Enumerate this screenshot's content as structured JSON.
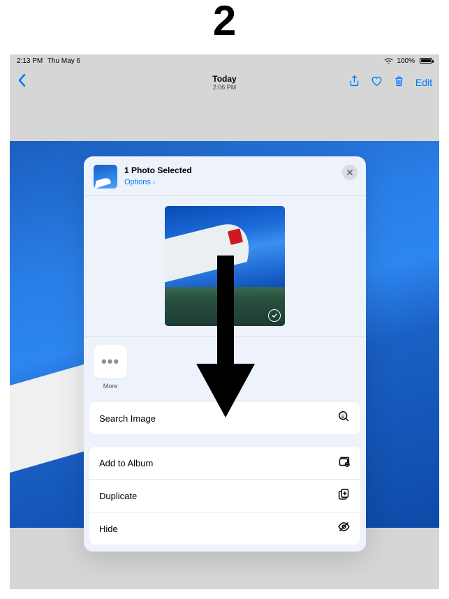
{
  "annotation_number": "2",
  "statusbar": {
    "time": "2:13 PM",
    "date": "Thu May 6",
    "battery": "100%",
    "wifi_full": true
  },
  "navbar": {
    "title_line1": "Today",
    "title_line2": "2:06 PM",
    "edit_label": "Edit"
  },
  "share_sheet": {
    "title": "1 Photo Selected",
    "options_label": "Options",
    "more_label": "More",
    "search_label": "Search Image",
    "add_to_album_label": "Add to Album",
    "duplicate_label": "Duplicate",
    "hide_label": "Hide"
  }
}
